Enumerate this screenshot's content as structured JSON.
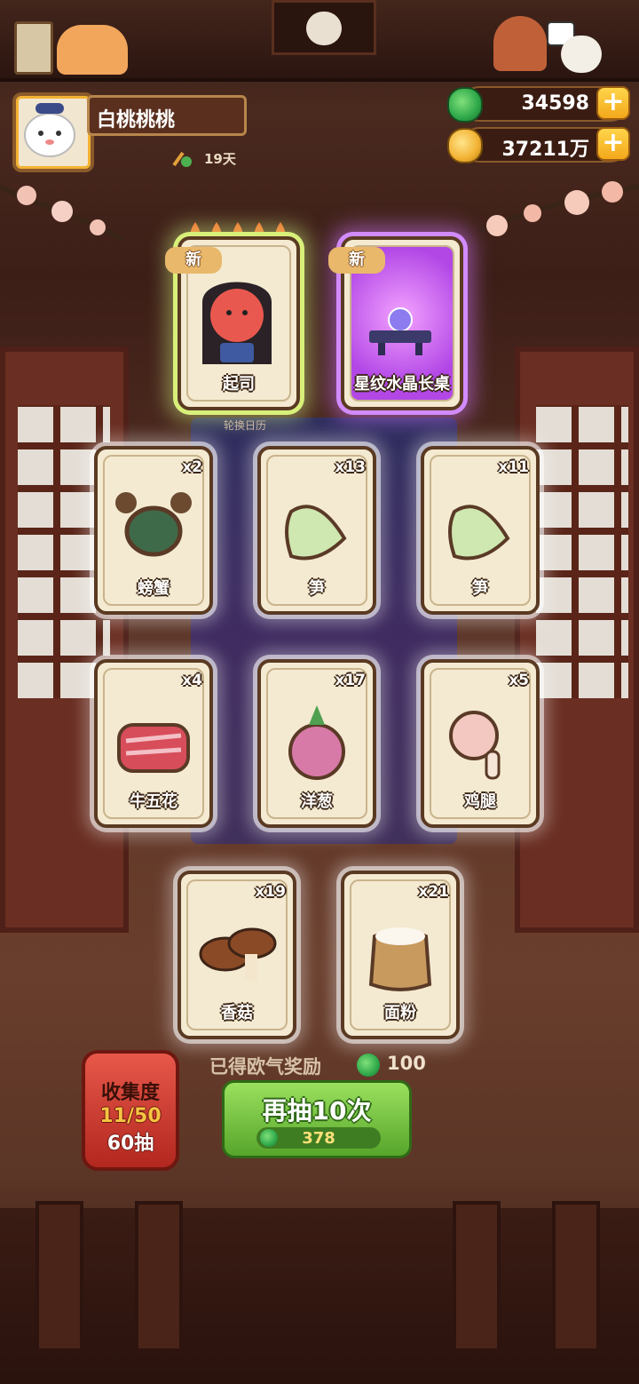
{
  "player": {
    "name": "白桃桃桃",
    "days": "19天"
  },
  "currency": {
    "jade": "34598",
    "coins": "37211万"
  },
  "board_caption": "轮换日历",
  "new_badge": "新",
  "special_cards": [
    {
      "name": "起司"
    },
    {
      "name": "星纹水晶长桌"
    }
  ],
  "item_cards": [
    {
      "name": "螃蟹",
      "qty": "x2"
    },
    {
      "name": "笋",
      "qty": "x13"
    },
    {
      "name": "笋",
      "qty": "x11"
    },
    {
      "name": "牛五花",
      "qty": "x4"
    },
    {
      "name": "洋葱",
      "qty": "x17"
    },
    {
      "name": "鸡腿",
      "qty": "x5"
    },
    {
      "name": "香菇",
      "qty": "x19"
    },
    {
      "name": "面粉",
      "qty": "x21"
    }
  ],
  "reward": {
    "label": "已得欧气奖励",
    "value": "100"
  },
  "draw_button": {
    "label": "再抽10次",
    "cost": "378"
  },
  "collection": {
    "title": "收集度",
    "progress": "11/50",
    "draws": "60抽"
  },
  "colors": {
    "jade": "#2fa84a",
    "coin": "#f2b233",
    "button_green": "#6cc23a"
  }
}
